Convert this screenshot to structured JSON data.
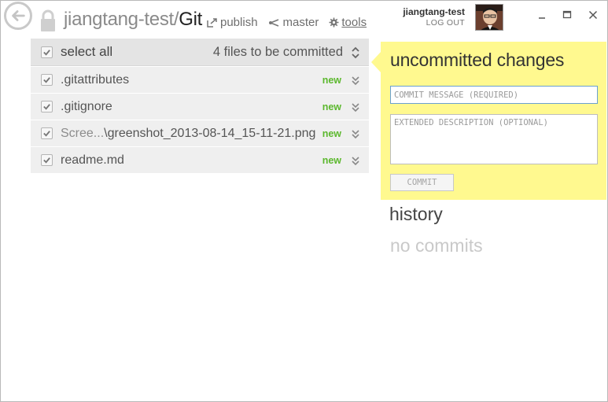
{
  "header": {
    "repo_owner": "jiangtang-test/",
    "repo_name": "Git",
    "toolbar": {
      "publish_label": "publish",
      "branch_label": "master",
      "tools_label": "tools"
    },
    "user": {
      "name": "jiangtang-test",
      "logout_label": "LOG OUT"
    }
  },
  "file_list": {
    "select_all_label": "select all",
    "count_label": "4 files to be committed",
    "files": [
      {
        "name_prefix": "",
        "name": ".gitattributes",
        "status": "new",
        "checked": true
      },
      {
        "name_prefix": "",
        "name": ".gitignore",
        "status": "new",
        "checked": true
      },
      {
        "name_prefix": "Scree...",
        "name": "\\greenshot_2013-08-14_15-11-21.png",
        "status": "new",
        "checked": true
      },
      {
        "name_prefix": "",
        "name": "readme.md",
        "status": "new",
        "checked": true
      }
    ]
  },
  "commit_panel": {
    "title": "uncommitted changes",
    "message_placeholder": "COMMIT MESSAGE (REQUIRED)",
    "description_placeholder": "EXTENDED DESCRIPTION (OPTIONAL)",
    "commit_button_label": "COMMIT"
  },
  "history": {
    "title": "history",
    "empty_label": "no commits"
  },
  "colors": {
    "panel_bg": "#fff98f",
    "status_new": "#5cb82e"
  }
}
